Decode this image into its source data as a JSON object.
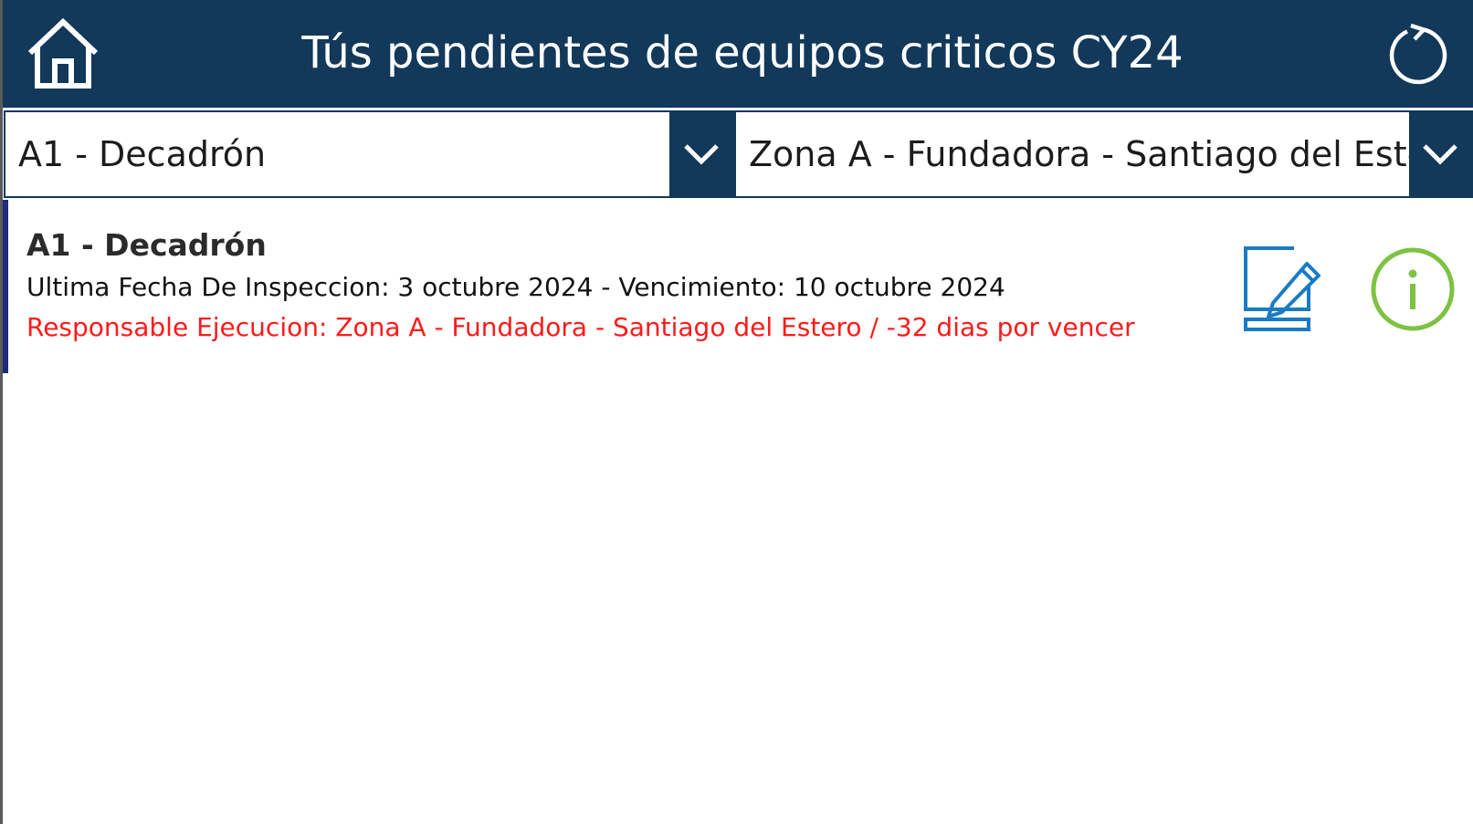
{
  "header": {
    "title": "Tús pendientes de equipos criticos CY24",
    "home_icon": "home-icon",
    "refresh_icon": "refresh-icon"
  },
  "filters": {
    "equipment_selected": "A1 - Decadrón",
    "zone_selected": "Zona A - Fundadora - Santiago del Estero"
  },
  "items": [
    {
      "title": "A1 - Decadrón",
      "dates_line": "Ultima Fecha De Inspeccion:  3 octubre 2024 -  Vencimiento: 10 octubre 2024",
      "responsable_line": "Responsable Ejecucion: Zona A - Fundadora - Santiago del Estero / -32 dias por vencer",
      "edit_icon": "edit-icon",
      "info_icon": "info-icon"
    }
  ],
  "colors": {
    "header_bg": "#12385a",
    "overdue_text": "#ff1a1a",
    "edit_icon": "#1a7bc4",
    "info_icon": "#7dc242",
    "selection_bar": "#1d2a7a"
  }
}
